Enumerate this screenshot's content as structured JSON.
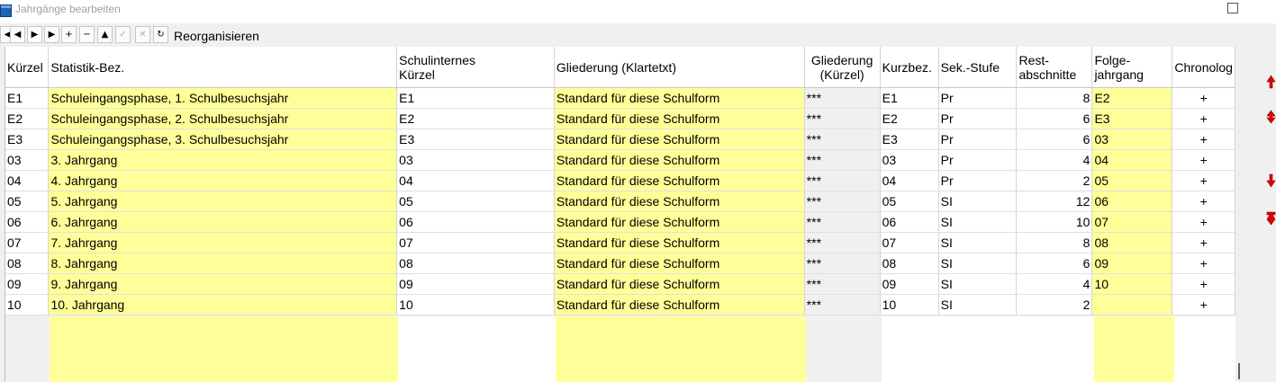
{
  "window": {
    "title": "Jahrgänge bearbeiten"
  },
  "toolbar": {
    "buttons": [
      {
        "name": "first-record-button",
        "glyph": "◀",
        "disabled": false
      },
      {
        "name": "prev-record-button",
        "glyph": "◀",
        "disabled": false
      },
      {
        "name": "next-record-button",
        "glyph": "▶",
        "disabled": false
      },
      {
        "name": "last-record-button",
        "glyph": "▶",
        "disabled": false
      },
      {
        "name": "insert-button",
        "glyph": "+",
        "disabled": false
      },
      {
        "name": "delete-button",
        "glyph": "−",
        "disabled": false
      },
      {
        "name": "edit-button",
        "glyph": "▲",
        "disabled": false
      },
      {
        "name": "post-button",
        "glyph": "✓",
        "disabled": true
      },
      {
        "name": "cancel-button",
        "glyph": "✕",
        "disabled": true
      },
      {
        "name": "refresh-button",
        "glyph": "↻",
        "disabled": false
      }
    ],
    "reorganize_label": "Reorganisieren"
  },
  "grid": {
    "headers": [
      "Kürzel",
      "Statistik-Bez.",
      "Schulinternes Kürzel",
      "Gliederung (Klartetxt)",
      "Gliederung (Kürzel)",
      "Kurzbez.",
      "Sek.-Stufe",
      "Rest-abschnitte",
      "Folge-jahrgang",
      "Chronolog"
    ],
    "header_lines": [
      [
        "Kürzel"
      ],
      [
        "Statistik-Bez."
      ],
      [
        "Schulinternes",
        "Kürzel"
      ],
      [
        "Gliederung (Klartetxt)"
      ],
      [
        "Gliederung",
        "(Kürzel)"
      ],
      [
        "Kurzbez."
      ],
      [
        "Sek.-Stufe"
      ],
      [
        "Rest-",
        "abschnitte"
      ],
      [
        "Folge-",
        "jahrgang"
      ],
      [
        "Chronolog"
      ]
    ],
    "rows": [
      [
        "E1",
        "Schuleingangsphase, 1. Schulbesuchsjahr",
        "E1",
        "Standard für diese Schulform",
        "***",
        "E1",
        "Pr",
        "8",
        "E2",
        "+"
      ],
      [
        "E2",
        "Schuleingangsphase, 2. Schulbesuchsjahr",
        "E2",
        "Standard für diese Schulform",
        "***",
        "E2",
        "Pr",
        "6",
        "E3",
        "+"
      ],
      [
        "E3",
        "Schuleingangsphase, 3. Schulbesuchsjahr",
        "E3",
        "Standard für diese Schulform",
        "***",
        "E3",
        "Pr",
        "6",
        "03",
        "+"
      ],
      [
        "03",
        "3. Jahrgang",
        "03",
        "Standard für diese Schulform",
        "***",
        "03",
        "Pr",
        "4",
        "04",
        "+"
      ],
      [
        "04",
        "4. Jahrgang",
        "04",
        "Standard für diese Schulform",
        "***",
        "04",
        "Pr",
        "2",
        "05",
        "+"
      ],
      [
        "05",
        "5. Jahrgang",
        "05",
        "Standard für diese Schulform",
        "***",
        "05",
        "SI",
        "12",
        "06",
        "+"
      ],
      [
        "06",
        "6. Jahrgang",
        "06",
        "Standard für diese Schulform",
        "***",
        "06",
        "SI",
        "10",
        "07",
        "+"
      ],
      [
        "07",
        "7. Jahrgang",
        "07",
        "Standard für diese Schulform",
        "***",
        "07",
        "SI",
        "8",
        "08",
        "+"
      ],
      [
        "08",
        "8. Jahrgang",
        "08",
        "Standard für diese Schulform",
        "***",
        "08",
        "SI",
        "6",
        "09",
        "+"
      ],
      [
        "09",
        "9. Jahrgang",
        "09",
        "Standard für diese Schulform",
        "***",
        "09",
        "SI",
        "4",
        "10",
        "+"
      ],
      [
        "10",
        "10. Jahrgang",
        "10",
        "Standard für diese Schulform",
        "***",
        "10",
        "SI",
        "2",
        "",
        "+"
      ]
    ]
  },
  "colors": {
    "editable_cell": "#ffff99",
    "readonly_cell": "#ffffff",
    "header": "#ffffff",
    "arrow": "#e00000"
  }
}
